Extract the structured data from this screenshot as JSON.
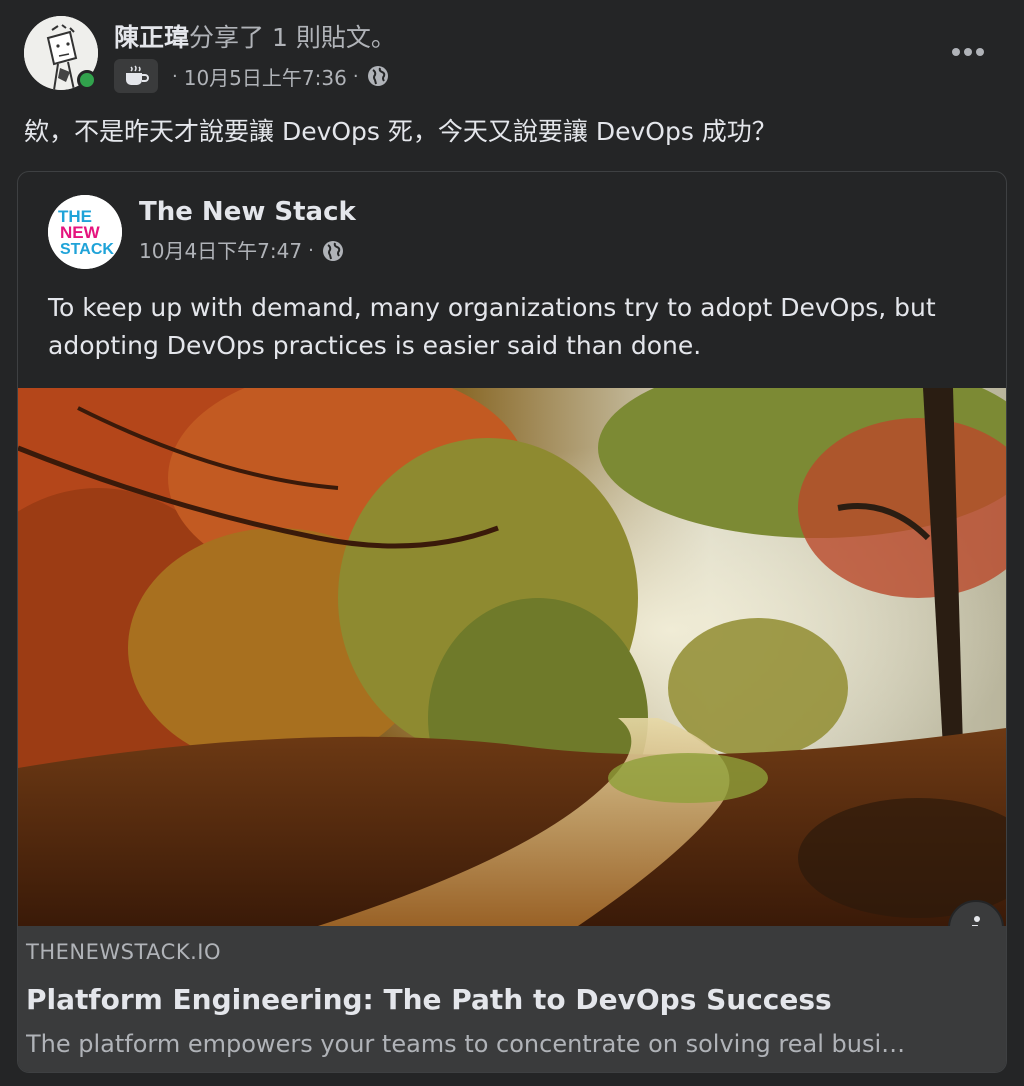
{
  "post": {
    "author_name": "陳正瑋",
    "action_text": "分享了 1 則貼文。",
    "timestamp": "10月5日上午7:36",
    "separator": "·",
    "privacy_icon": "globe-icon",
    "badge_icon": "coffee-cup-icon",
    "more_icon": "more-options-icon",
    "text": "欸，不是昨天才說要讓 DevOps 死，今天又說要讓 DevOps 成功？"
  },
  "shared": {
    "page_name": "The New Stack",
    "timestamp": "10月4日下午7:47",
    "separator": "·",
    "privacy_icon": "globe-icon",
    "logo_lines": [
      "THE",
      "NEW",
      "STACK"
    ],
    "text": "To keep up with demand, many organizations try to adopt DevOps, but adopting DevOps practices is easier said than done."
  },
  "link": {
    "domain": "THENEWSTACK.IO",
    "title": "Platform Engineering: The Path to DevOps Success",
    "description": "The platform empowers your teams to concentrate on solving real busi…",
    "info_icon": "info-icon"
  },
  "colors": {
    "background": "#242526",
    "link_area": "#3a3b3c",
    "online": "#31a24c",
    "logo_cyan": "#1fa3d8",
    "logo_magenta": "#e5147e"
  }
}
